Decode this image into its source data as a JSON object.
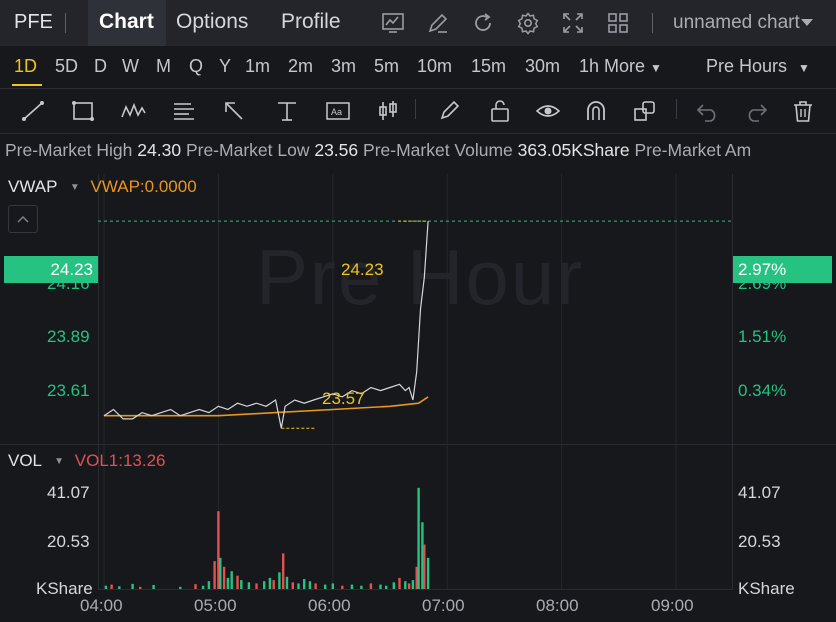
{
  "topbar": {
    "symbol": "PFE",
    "tabs": [
      "Chart",
      "Options",
      "Profile"
    ],
    "active_tab": "Chart",
    "chart_name": "unnamed chart",
    "icons": [
      "indicator-icon",
      "draw-icon",
      "refresh-icon",
      "settings-icon",
      "fullscreen-icon",
      "layout-icon",
      "chevron-down-icon"
    ]
  },
  "timeframes": {
    "items": [
      "1D",
      "5D",
      "D",
      "W",
      "M",
      "Q",
      "Y",
      "1m",
      "2m",
      "3m",
      "5m",
      "10m",
      "15m",
      "30m",
      "1h"
    ],
    "active": "1D",
    "more_label": "More",
    "session_label": "Pre Hours"
  },
  "drawing_tools": [
    "trendline-icon",
    "rectangle-icon",
    "pattern-icon",
    "fib-icon",
    "arrow-icon",
    "measure-icon",
    "text-icon",
    "candle-icon",
    "pencil-icon",
    "lock-icon",
    "eye-icon",
    "magnet-icon",
    "clone-icon",
    "undo-icon",
    "redo-icon",
    "trash-icon"
  ],
  "premarket": {
    "high_label": "Pre-Market High",
    "high_value": "24.30",
    "low_label": "Pre-Market Low",
    "low_value": "23.56",
    "volume_label": "Pre-Market Volume",
    "volume_value": "363.05KShare",
    "amount_label": "Pre-Market Am"
  },
  "price_panel": {
    "indicator_name": "VWAP",
    "indicator_value": "VWAP:0.0000",
    "watermark": "Pre Hour",
    "current_price": "24.23",
    "current_pct": "2.97%",
    "left_ticks": [
      "24.16",
      "23.89",
      "23.61"
    ],
    "right_ticks": [
      "2.69%",
      "1.51%",
      "0.34%"
    ],
    "high_annotation": "24.23",
    "low_annotation": "23.57"
  },
  "volume_panel": {
    "indicator_name": "VOL",
    "indicator_value": "VOL1:13.26",
    "left_ticks": [
      "41.07",
      "20.53",
      "KShare"
    ],
    "right_ticks": [
      "41.07",
      "20.53",
      "KShare"
    ]
  },
  "colors": {
    "up": "#26c281",
    "down": "#e0514f",
    "vwap": "#e8961e",
    "accent": "#f0c419",
    "price_line": "#d6d7da"
  },
  "chart_data": {
    "type": "line",
    "x_labels": [
      "04:00",
      "05:00",
      "06:00",
      "07:00",
      "08:00",
      "09:00"
    ],
    "price": {
      "x": [
        "04:00",
        "04:05",
        "04:10",
        "04:15",
        "04:20",
        "04:25",
        "04:30",
        "04:35",
        "04:40",
        "04:45",
        "04:50",
        "04:55",
        "05:00",
        "05:05",
        "05:10",
        "05:15",
        "05:20",
        "05:25",
        "05:30",
        "05:33",
        "05:35",
        "05:40",
        "05:45",
        "05:50",
        "05:55",
        "06:00",
        "06:05",
        "06:10",
        "06:15",
        "06:20",
        "06:25",
        "06:30",
        "06:35",
        "06:38",
        "06:40",
        "06:42",
        "06:44",
        "06:46",
        "06:48",
        "06:50"
      ],
      "y": [
        23.61,
        23.63,
        23.6,
        23.6,
        23.62,
        23.61,
        23.62,
        23.63,
        23.61,
        23.62,
        23.63,
        23.62,
        23.64,
        23.63,
        23.65,
        23.64,
        23.65,
        23.64,
        23.66,
        23.57,
        23.64,
        23.66,
        23.65,
        23.66,
        23.67,
        23.68,
        23.67,
        23.69,
        23.68,
        23.7,
        23.69,
        23.7,
        23.71,
        23.69,
        23.7,
        23.66,
        23.75,
        23.95,
        24.05,
        24.23
      ]
    },
    "vwap": {
      "x": [
        "04:00",
        "04:30",
        "05:00",
        "05:30",
        "06:00",
        "06:30",
        "06:45",
        "06:50"
      ],
      "y": [
        23.61,
        23.61,
        23.61,
        23.62,
        23.63,
        23.64,
        23.65,
        23.67
      ]
    },
    "price_ylim": [
      23.52,
      24.38
    ],
    "volume_ylim": [
      0,
      61.6
    ],
    "volume_unit": "KShare",
    "volume": [
      {
        "x": "04:01",
        "v": 1.5,
        "up": true
      },
      {
        "x": "04:04",
        "v": 2.0,
        "up": false
      },
      {
        "x": "04:08",
        "v": 1.2,
        "up": true
      },
      {
        "x": "04:15",
        "v": 2.3,
        "up": true
      },
      {
        "x": "04:19",
        "v": 1.0,
        "up": false
      },
      {
        "x": "04:26",
        "v": 1.8,
        "up": true
      },
      {
        "x": "04:40",
        "v": 1.0,
        "up": true
      },
      {
        "x": "04:48",
        "v": 2.2,
        "up": false
      },
      {
        "x": "04:52",
        "v": 1.5,
        "up": true
      },
      {
        "x": "04:55",
        "v": 3.5,
        "up": true
      },
      {
        "x": "04:58",
        "v": 12.5,
        "up": false
      },
      {
        "x": "05:00",
        "v": 35.0,
        "up": false
      },
      {
        "x": "05:01",
        "v": 14.0,
        "up": true
      },
      {
        "x": "05:03",
        "v": 10.0,
        "up": false
      },
      {
        "x": "05:05",
        "v": 5.0,
        "up": true
      },
      {
        "x": "05:07",
        "v": 8.0,
        "up": true
      },
      {
        "x": "05:10",
        "v": 6.0,
        "up": false
      },
      {
        "x": "05:12",
        "v": 4.0,
        "up": true
      },
      {
        "x": "05:16",
        "v": 3.0,
        "up": true
      },
      {
        "x": "05:20",
        "v": 2.5,
        "up": false
      },
      {
        "x": "05:24",
        "v": 3.5,
        "up": true
      },
      {
        "x": "05:27",
        "v": 5.0,
        "up": true
      },
      {
        "x": "05:29",
        "v": 4.0,
        "up": false
      },
      {
        "x": "05:32",
        "v": 7.5,
        "up": true
      },
      {
        "x": "05:34",
        "v": 16.0,
        "up": false
      },
      {
        "x": "05:36",
        "v": 5.5,
        "up": true
      },
      {
        "x": "05:39",
        "v": 3.0,
        "up": false
      },
      {
        "x": "05:42",
        "v": 2.5,
        "up": true
      },
      {
        "x": "05:45",
        "v": 4.5,
        "up": true
      },
      {
        "x": "05:48",
        "v": 3.5,
        "up": true
      },
      {
        "x": "05:51",
        "v": 2.5,
        "up": false
      },
      {
        "x": "05:56",
        "v": 2.0,
        "up": true
      },
      {
        "x": "06:00",
        "v": 2.5,
        "up": true
      },
      {
        "x": "06:05",
        "v": 1.5,
        "up": false
      },
      {
        "x": "06:10",
        "v": 2.0,
        "up": true
      },
      {
        "x": "06:15",
        "v": 1.5,
        "up": true
      },
      {
        "x": "06:20",
        "v": 2.5,
        "up": false
      },
      {
        "x": "06:25",
        "v": 2.0,
        "up": true
      },
      {
        "x": "06:28",
        "v": 1.5,
        "up": true
      },
      {
        "x": "06:32",
        "v": 3.0,
        "up": true
      },
      {
        "x": "06:35",
        "v": 5.0,
        "up": false
      },
      {
        "x": "06:38",
        "v": 3.5,
        "up": true
      },
      {
        "x": "06:40",
        "v": 2.5,
        "up": false
      },
      {
        "x": "06:42",
        "v": 4.0,
        "up": true
      },
      {
        "x": "06:44",
        "v": 10.0,
        "up": false
      },
      {
        "x": "06:45",
        "v": 45.5,
        "up": true
      },
      {
        "x": "06:47",
        "v": 30.0,
        "up": true
      },
      {
        "x": "06:48",
        "v": 20.0,
        "up": false
      },
      {
        "x": "06:50",
        "v": 14.0,
        "up": true
      }
    ]
  }
}
